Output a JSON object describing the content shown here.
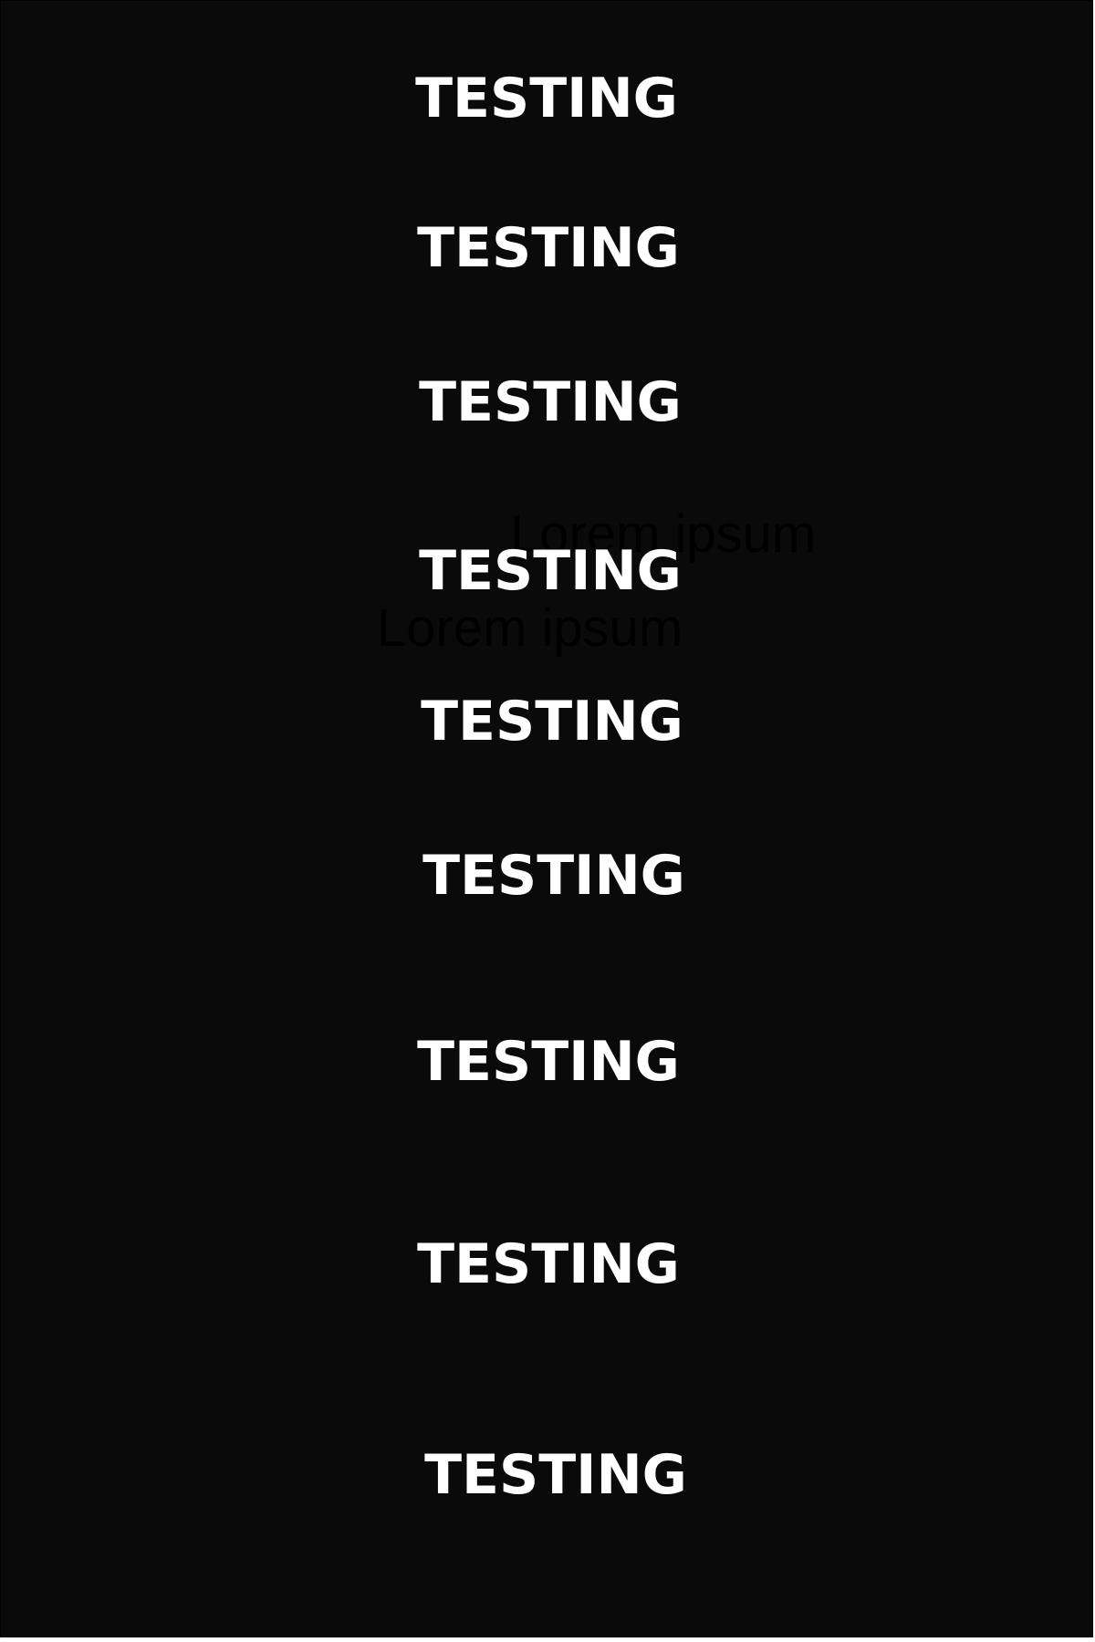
{
  "colors": {
    "background": "#0a0a0a",
    "label_text": "#ffffff",
    "ghost_text": "#000000"
  },
  "labels": [
    "TESTING",
    "TESTING",
    "TESTING",
    "TESTING",
    "TESTING",
    "TESTING",
    "TESTING",
    "TESTING",
    "TESTING"
  ],
  "ghost_texts": [
    "Lorem ipsum",
    "Lorem ipsum"
  ]
}
